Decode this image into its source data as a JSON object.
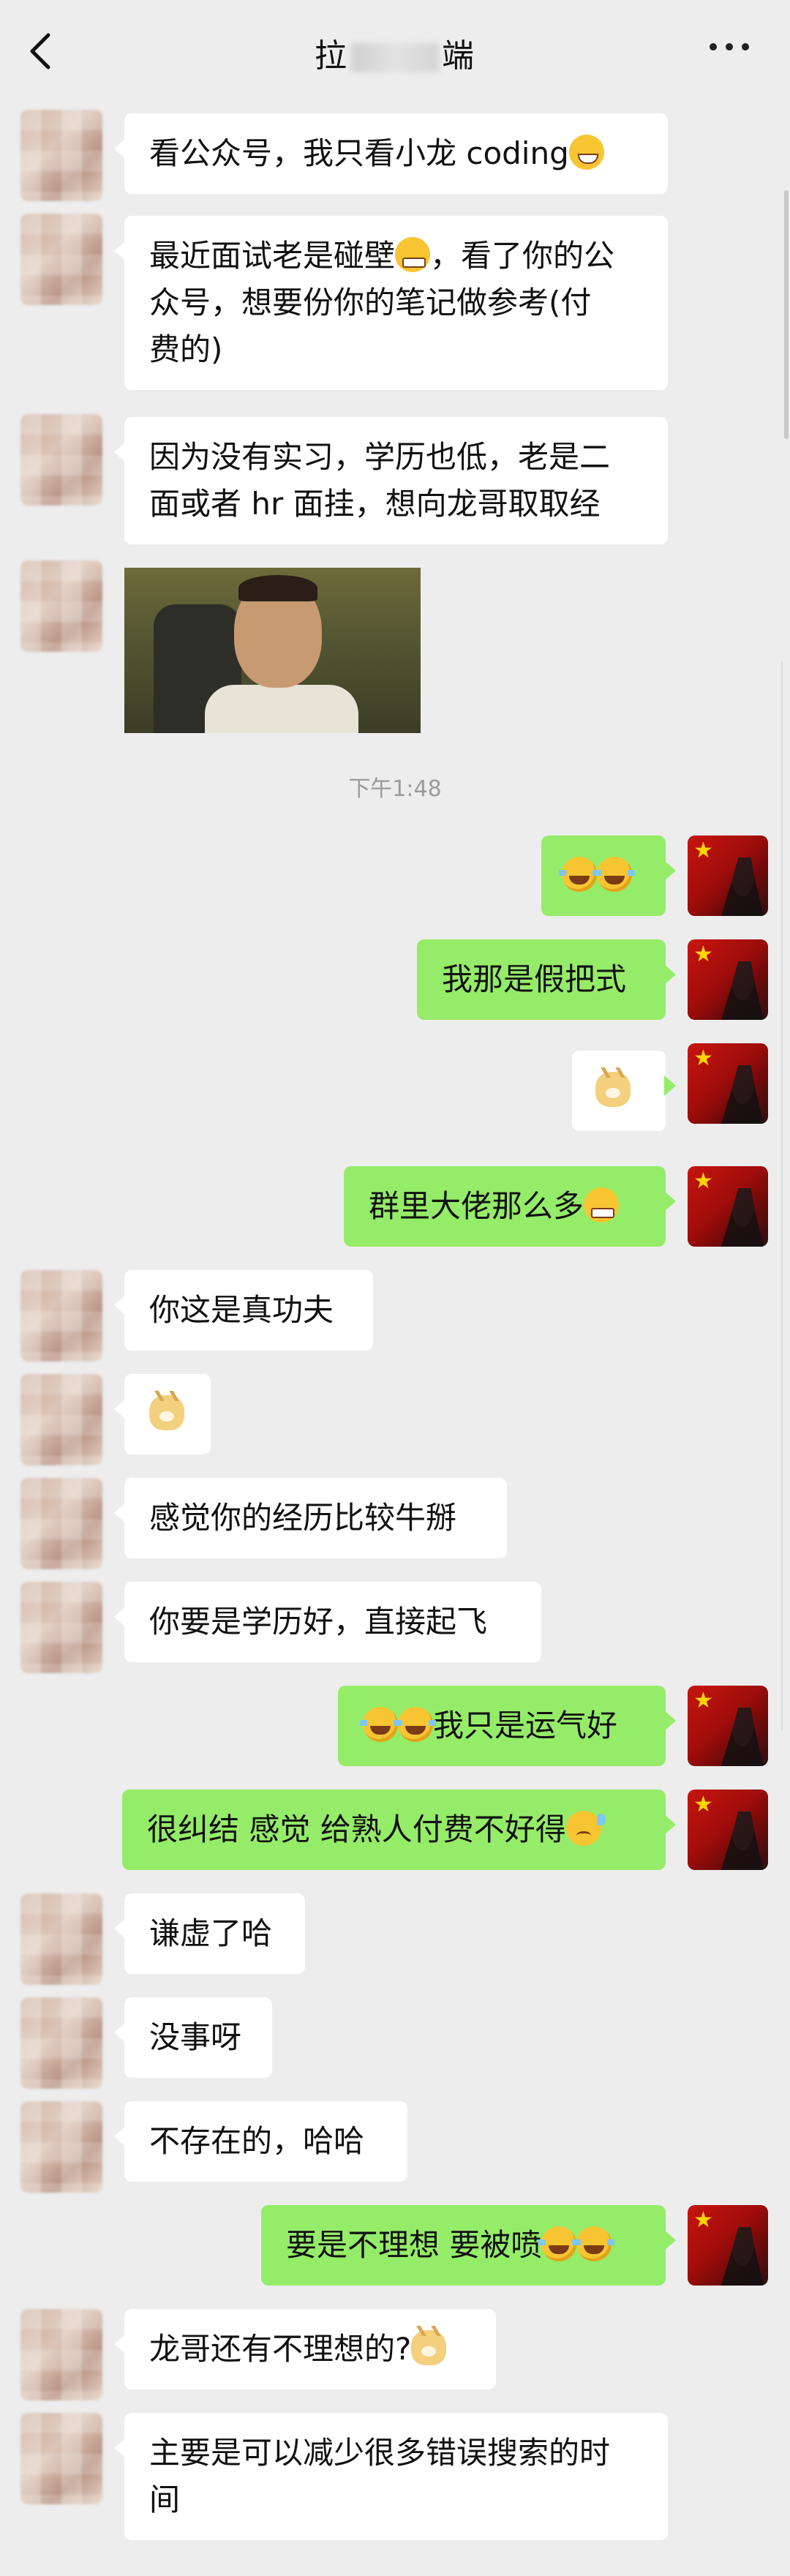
{
  "header": {
    "title_left": "拉",
    "title_right": "端",
    "back_icon": "chevron-left-icon",
    "more_icon": "more-dots-icon"
  },
  "messages": [
    {
      "side": "in",
      "text": "看公众号，我只看小龙 coding",
      "emoji": "grin"
    },
    {
      "side": "in",
      "line1": "最近面试老是碰壁",
      "emoji": "grimace",
      "line1b": "，看了你的公",
      "line2": "众号，想要份你的笔记做参考(付",
      "line3": "费的)"
    },
    {
      "side": "in",
      "line1": "因为没有实习，学历也低，老是二",
      "line2": "面或者 hr 面挂，想向龙哥取取经"
    },
    {
      "side": "in",
      "type": "image",
      "image_desc": "sticker"
    },
    {
      "type": "time",
      "text": "下午1:48"
    },
    {
      "side": "out",
      "text": "",
      "emoji": "laugh-laugh"
    },
    {
      "side": "out",
      "text": "我那是假把式"
    },
    {
      "side": "out",
      "text": "",
      "emoji": "doge"
    },
    {
      "side": "out",
      "text": "群里大佬那么多",
      "emoji": "grin"
    },
    {
      "side": "in",
      "text": "你这是真功夫"
    },
    {
      "side": "in",
      "text": "",
      "emoji": "doge"
    },
    {
      "side": "in",
      "text": "感觉你的经历比较牛掰"
    },
    {
      "side": "in",
      "text": "你要是学历好，直接起飞"
    },
    {
      "side": "out",
      "text": "我只是运气好",
      "emoji": "laugh-laugh"
    },
    {
      "side": "out",
      "text": "很纠结 感觉 给熟人付费不好得",
      "emoji": "sweat"
    },
    {
      "side": "in",
      "text": "谦虚了哈"
    },
    {
      "side": "in",
      "text": "没事呀"
    },
    {
      "side": "in",
      "text": "不存在的，哈哈"
    },
    {
      "side": "out",
      "text": "要是不理想 要被喷",
      "emoji": "laugh-laugh"
    },
    {
      "side": "in",
      "text": "龙哥还有不理想的?",
      "emoji": "doge"
    },
    {
      "side": "in",
      "line1": "主要是可以减少很多错误搜索的时",
      "line2": "间"
    }
  ],
  "colors": {
    "background": "#ededed",
    "incoming_bubble": "#ffffff",
    "outgoing_bubble": "#95ec69",
    "timestamp": "#9b9b9b"
  }
}
